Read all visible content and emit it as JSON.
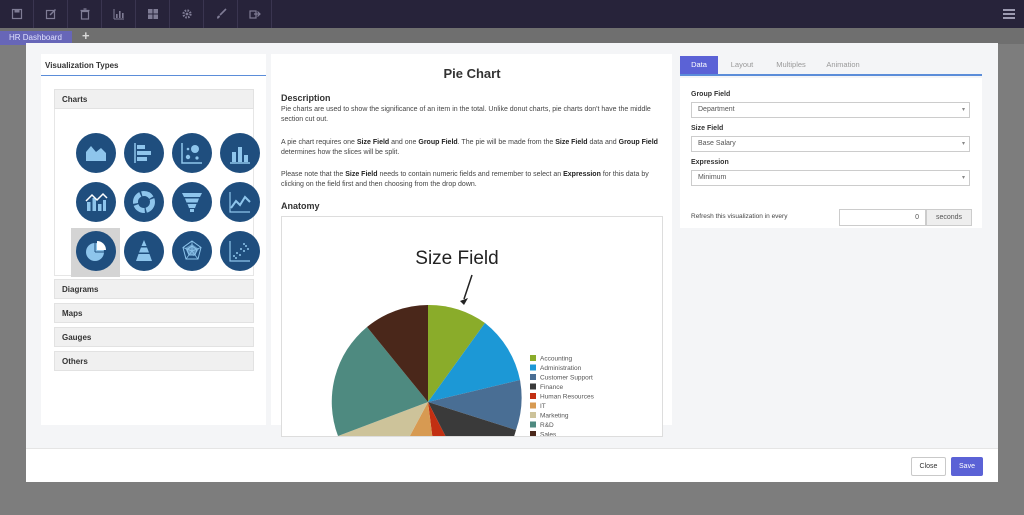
{
  "toolbar": {
    "icons": [
      "save-icon",
      "edit-icon",
      "trash-icon",
      "bar-chart-icon",
      "dashboard-grid-icon",
      "gear-icon",
      "brush-icon",
      "share-icon"
    ],
    "menu_icon": "hamburger-icon"
  },
  "tabs": {
    "active": "HR Dashboard",
    "add": "+"
  },
  "left": {
    "title": "Visualization Types",
    "sections": [
      "Charts",
      "Diagrams",
      "Maps",
      "Gauges",
      "Others"
    ],
    "icons": [
      "area-chart",
      "bar-horizontal",
      "bubble-chart",
      "column-chart",
      "combo-chart",
      "donut-chart",
      "funnel-chart",
      "line-chart",
      "pie-chart",
      "pyramid-chart",
      "radar-chart",
      "scatter-chart"
    ],
    "selected": "pie-chart"
  },
  "center": {
    "title": "Pie Chart",
    "description_heading": "Description",
    "p1": "Pie charts are used to show the significance of an item in the total. Unlike donut charts, pie charts don't have the middle section cut out.",
    "p2_a": "A pie chart requires one ",
    "p2_b": "Size Field",
    "p2_c": " and one ",
    "p2_d": "Group Field",
    "p2_e": ". The pie will be made from the ",
    "p2_f": "Size Field",
    "p2_g": " data and ",
    "p2_h": "Group Field",
    "p2_i": " determines how the slices will be split.",
    "p3_a": "Please note that the ",
    "p3_b": "Size Field",
    "p3_c": " needs to contain numeric fields and remember to select an ",
    "p3_d": "Expression",
    "p3_e": " for this data by clicking on the field first and then choosing from the drop down.",
    "anatomy_heading": "Anatomy",
    "anatomy_label": "Size Field",
    "legend": [
      "Accounting",
      "Administration",
      "Customer Support",
      "Finance",
      "Human Resources",
      "IT",
      "Marketing",
      "R&D",
      "Sales"
    ],
    "legend_colors": [
      "#8aac2a",
      "#1c98d6",
      "#496e94",
      "#3a3a3a",
      "#c22f12",
      "#d79a52",
      "#cdc39a",
      "#4e8a80",
      "#4a271a"
    ]
  },
  "right": {
    "tabs": [
      "Data",
      "Layout",
      "Multiples",
      "Animation"
    ],
    "active_tab": "Data",
    "group_field_label": "Group Field",
    "group_field_value": "Department",
    "size_field_label": "Size Field",
    "size_field_value": "Base Salary",
    "expression_label": "Expression",
    "expression_value": "Minimum",
    "refresh_label": "Refresh this visualization in every",
    "refresh_value": "0",
    "refresh_unit": "seconds"
  },
  "footer": {
    "close_label": "Close",
    "save_label": "Save"
  },
  "colors": {
    "accent": "#5b62d6",
    "toolbar": "#27233a",
    "icon_bg": "#1f4e7e",
    "icon_fg": "#8ec5ec"
  }
}
